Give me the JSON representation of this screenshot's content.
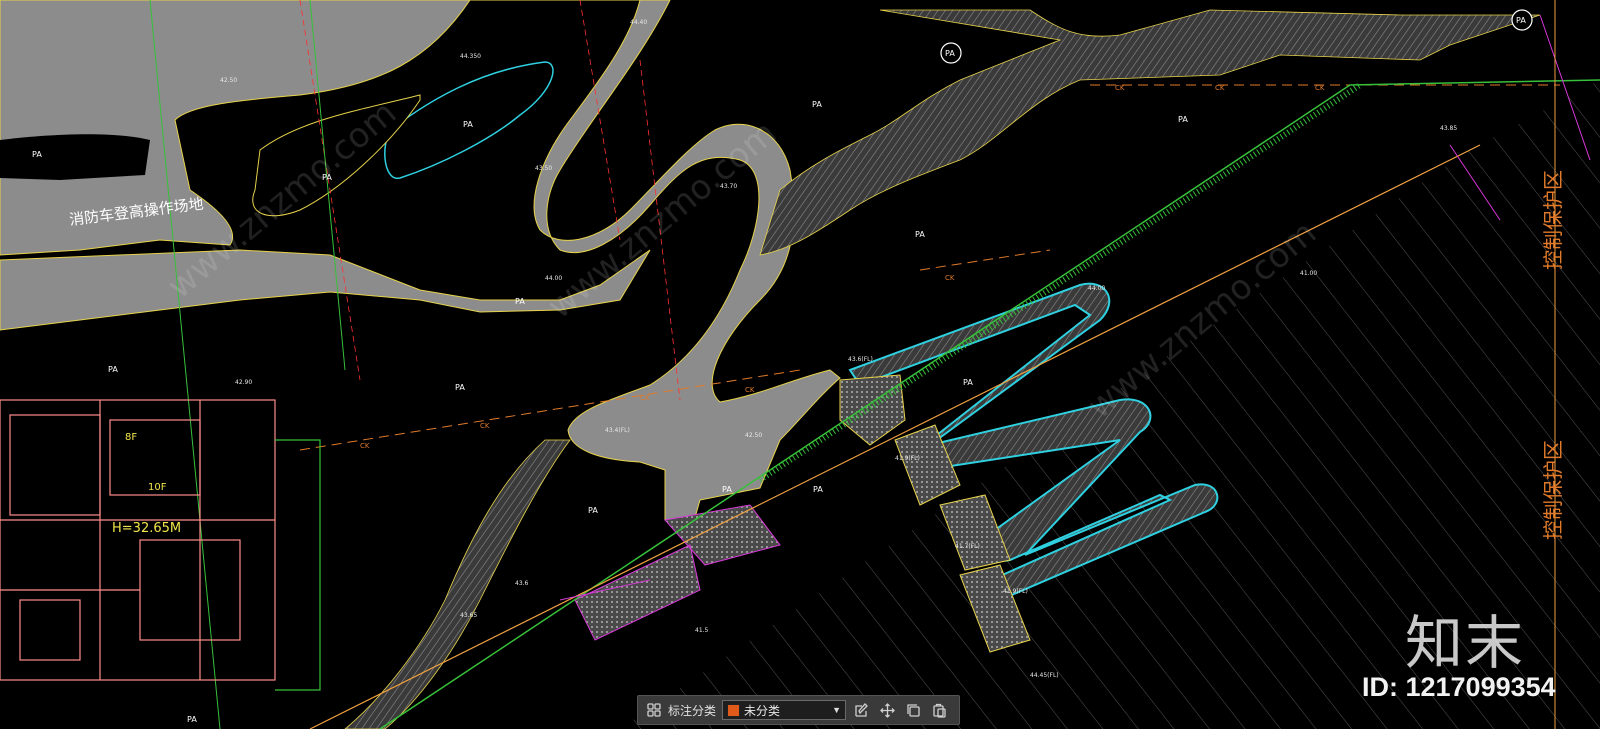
{
  "colors": {
    "background": "#000000",
    "road_fill": "#8c8c8c",
    "path_hatch": "#5a5a5a",
    "water": "#3b78c0",
    "building_lines": "#ff8c8c",
    "cyan_outline": "#2fd0e0",
    "green_line": "#37c03a",
    "orange_dash": "#e07a2a",
    "yellow_text": "#f0e64a",
    "magenta": "#d838d8",
    "red_label": "#ff3030",
    "swatch": "#e05a1a"
  },
  "drawing": {
    "fire_zone": "消防车登高操作场地",
    "control_zone_top": "控制保护区",
    "control_zone_bottom": "控制保护区",
    "pa_label": "PA",
    "ck_label": "CK",
    "building_height": "H=32.65M",
    "floor_8f": "8F",
    "floor_10f": "10F",
    "elevations": [
      "44.350",
      "44.40",
      "44.00",
      "43.70",
      "43.50",
      "42.50",
      "41.9(FL)",
      "43.6(FL)",
      "41.7(FL)",
      "43.4(FL)",
      "42.50",
      "43.6",
      "44.00",
      "43.65",
      "41.5",
      "41.9(FL)",
      "42.90",
      "43.85",
      "41.00",
      "44.45(FL)"
    ]
  },
  "toolbar": {
    "grid_icon": "grid-icon",
    "label": "标注分类",
    "selected": "未分类",
    "swatch_color": "#e05a1a",
    "actions": [
      "edit-icon",
      "move-icon",
      "copy-icon",
      "paste-icon"
    ]
  },
  "watermark": {
    "brand": "知末",
    "id": "ID: 1217099354",
    "site": "www.znzmo.com"
  }
}
